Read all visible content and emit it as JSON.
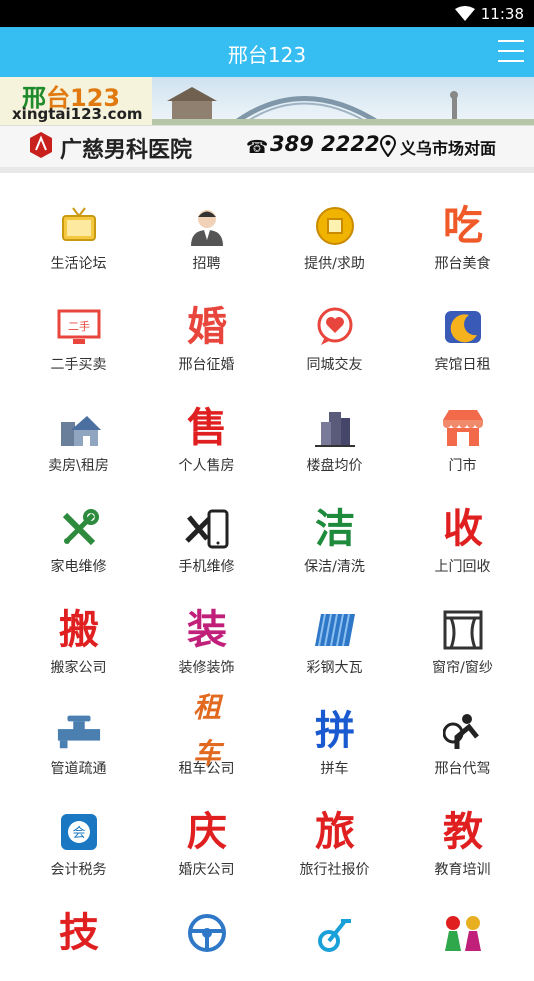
{
  "status_bar": {
    "time": "11:38"
  },
  "app_bar": {
    "title": "邢台123"
  },
  "banner": {
    "logo_prefix": "邢",
    "logo_rest": "台123",
    "logo_url": "xingtai123.com",
    "hospital": "广慈男科医院",
    "phone": "389 2222",
    "location": "义乌市场对面"
  },
  "categories": [
    {
      "label": "生活论坛",
      "icon": "tv-icon",
      "glyph": "",
      "color": "#e8b020"
    },
    {
      "label": "招聘",
      "icon": "person-icon",
      "glyph": "",
      "color": "#555555"
    },
    {
      "label": "提供/求助",
      "icon": "coin-icon",
      "glyph": "",
      "color": "#e0a000"
    },
    {
      "label": "邢台美食",
      "icon": "eat-icon",
      "glyph": "吃",
      "color": "#f05a28"
    },
    {
      "label": "二手买卖",
      "icon": "secondhand-icon",
      "glyph": "",
      "color": "#e8453c"
    },
    {
      "label": "邢台征婚",
      "icon": "marriage-icon",
      "glyph": "婚",
      "color": "#e8453c"
    },
    {
      "label": "同城交友",
      "icon": "chat-heart-icon",
      "glyph": "",
      "color": "#e8453c"
    },
    {
      "label": "宾馆日租",
      "icon": "moon-icon",
      "glyph": "",
      "color": "#f2a41c"
    },
    {
      "label": "卖房\\租房",
      "icon": "house-icon",
      "glyph": "",
      "color": "#4a6fa0"
    },
    {
      "label": "个人售房",
      "icon": "sell-icon",
      "glyph": "售",
      "color": "#e02020"
    },
    {
      "label": "楼盘均价",
      "icon": "building-icon",
      "glyph": "",
      "color": "#555577"
    },
    {
      "label": "门市",
      "icon": "shop-icon",
      "glyph": "",
      "color": "#f26a4a"
    },
    {
      "label": "家电维修",
      "icon": "tools-icon",
      "glyph": "",
      "color": "#2e8a3c"
    },
    {
      "label": "手机维修",
      "icon": "phone-repair-icon",
      "glyph": "",
      "color": "#222222"
    },
    {
      "label": "保洁/清洗",
      "icon": "clean-icon",
      "glyph": "洁",
      "color": "#1e8a3c"
    },
    {
      "label": "上门回收",
      "icon": "recycle-icon",
      "glyph": "收",
      "color": "#e02020"
    },
    {
      "label": "搬家公司",
      "icon": "moving-icon",
      "glyph": "搬",
      "color": "#e02020"
    },
    {
      "label": "装修装饰",
      "icon": "decor-icon",
      "glyph": "装",
      "color": "#c0207a"
    },
    {
      "label": "彩钢大瓦",
      "icon": "steel-tile-icon",
      "glyph": "",
      "color": "#2f78c8"
    },
    {
      "label": "窗帘/窗纱",
      "icon": "curtain-icon",
      "glyph": "",
      "color": "#333333"
    },
    {
      "label": "管道疏通",
      "icon": "pipe-icon",
      "glyph": "",
      "color": "#4a7fb0"
    },
    {
      "label": "租车公司",
      "icon": "car-rent-icon",
      "glyph": "租车",
      "color": "#e26a20"
    },
    {
      "label": "拼车",
      "icon": "carpool-icon",
      "glyph": "拼",
      "color": "#1a5ad0"
    },
    {
      "label": "邢台代驾",
      "icon": "driver-icon",
      "glyph": "",
      "color": "#222222"
    },
    {
      "label": "会计税务",
      "icon": "accounting-icon",
      "glyph": "",
      "color": "#1a78c2"
    },
    {
      "label": "婚庆公司",
      "icon": "wedding-icon",
      "glyph": "庆",
      "color": "#e02020"
    },
    {
      "label": "旅行社报价",
      "icon": "travel-icon",
      "glyph": "旅",
      "color": "#e02020"
    },
    {
      "label": "教育培训",
      "icon": "education-icon",
      "glyph": "教",
      "color": "#e02020"
    },
    {
      "label": "",
      "icon": "skill-icon",
      "glyph": "技",
      "color": "#e02020"
    },
    {
      "label": "",
      "icon": "steering-wheel-icon",
      "glyph": "",
      "color": "#2f78c8"
    },
    {
      "label": "",
      "icon": "fitness-icon",
      "glyph": "",
      "color": "#1aa0d8"
    },
    {
      "label": "",
      "icon": "kids-icon",
      "glyph": "",
      "color": "#2ea84a"
    }
  ]
}
